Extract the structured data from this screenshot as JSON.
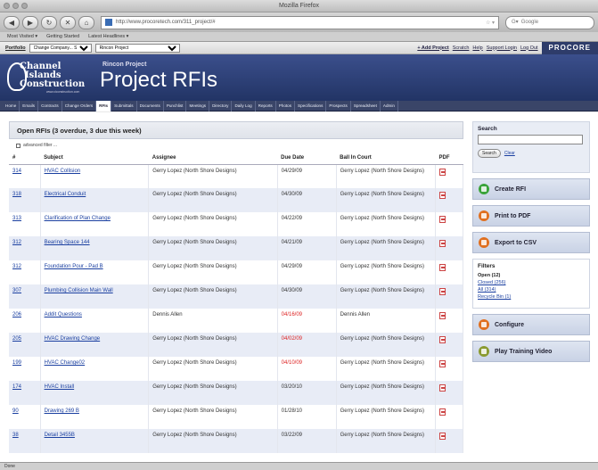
{
  "window": {
    "title": "Mozilla Firefox"
  },
  "browser": {
    "url": "http://www.procoretech.com/311_project/#",
    "search_placeholder": "Google",
    "bookmarks": [
      "Most Visited ▾",
      "Getting Started",
      "Latest Headlines ▾"
    ]
  },
  "appbar": {
    "portfolio_label": "Portfolio",
    "company_select": "Change Company... Supervisor ▾",
    "project_select": "Rincon Project",
    "links": [
      "+ Add Project",
      "Scratch",
      "Help",
      "Support Login",
      "Log Out"
    ],
    "brand": "PROCORE"
  },
  "header": {
    "logo": [
      "Channel",
      "Islands",
      "Construction",
      "www.ciconstruction.com"
    ],
    "subtitle": "Rincon Project",
    "title": "Project RFIs"
  },
  "tabs": [
    {
      "label": "Home",
      "active": false
    },
    {
      "label": "Emails",
      "active": false
    },
    {
      "label": "Contracts",
      "active": false
    },
    {
      "label": "Change Orders",
      "active": false
    },
    {
      "label": "RFIs",
      "active": true
    },
    {
      "label": "Submittals",
      "active": false
    },
    {
      "label": "Documents",
      "active": false
    },
    {
      "label": "Punchlist",
      "active": false
    },
    {
      "label": "Meetings",
      "active": false
    },
    {
      "label": "Directory",
      "active": false
    },
    {
      "label": "Daily Log",
      "active": false
    },
    {
      "label": "Reports",
      "active": false
    },
    {
      "label": "Photos",
      "active": false
    },
    {
      "label": "Specifications",
      "active": false
    },
    {
      "label": "Prospects",
      "active": false
    },
    {
      "label": "Spreadsheet",
      "active": false
    },
    {
      "label": "Admin",
      "active": false
    }
  ],
  "main": {
    "section_title": "Open RFIs (3 overdue, 3 due this week)",
    "advanced_filter": "advanced filter ..."
  },
  "table": {
    "headers": [
      "#",
      "Subject",
      "Assignee",
      "Due Date",
      "Ball In Court",
      "PDF"
    ],
    "rows": [
      {
        "num": "314",
        "subject": "HVAC Collision",
        "assignee": "Gerry Lopez (North Shore Designs)",
        "due": "04/29/09",
        "ball": "Gerry Lopez (North Shore Designs)",
        "overdue": false
      },
      {
        "num": "318",
        "subject": "Electrical Conduit",
        "assignee": "Gerry Lopez (North Shore Designs)",
        "due": "04/30/09",
        "ball": "Gerry Lopez (North Shore Designs)",
        "overdue": false
      },
      {
        "num": "313",
        "subject": "Clarification of Plan Change",
        "assignee": "Gerry Lopez (North Shore Designs)",
        "due": "04/22/09",
        "ball": "Gerry Lopez (North Shore Designs)",
        "overdue": false
      },
      {
        "num": "312",
        "subject": "Bearing Space 144",
        "assignee": "Gerry Lopez (North Shore Designs)",
        "due": "04/21/09",
        "ball": "Gerry Lopez (North Shore Designs)",
        "overdue": false
      },
      {
        "num": "312",
        "subject": "Foundation Pour - Pad B",
        "assignee": "Gerry Lopez (North Shore Designs)",
        "due": "04/29/09",
        "ball": "Gerry Lopez (North Shore Designs)",
        "overdue": false
      },
      {
        "num": "307",
        "subject": "Plumbing Collision Main Wall",
        "assignee": "Gerry Lopez (North Shore Designs)",
        "due": "04/30/09",
        "ball": "Gerry Lopez (North Shore Designs)",
        "overdue": false
      },
      {
        "num": "206",
        "subject": "Addit Questions",
        "assignee": "Dennis Allen",
        "due": "04/16/09",
        "ball": "Dennis Allen",
        "overdue": true
      },
      {
        "num": "205",
        "subject": "HVAC Drawing Change",
        "assignee": "Gerry Lopez (North Shore Designs)",
        "due": "04/02/09",
        "ball": "Gerry Lopez (North Shore Designs)",
        "overdue": true
      },
      {
        "num": "199",
        "subject": "HVAC Change02",
        "assignee": "Gerry Lopez (North Shore Designs)",
        "due": "04/10/09",
        "ball": "Gerry Lopez (North Shore Designs)",
        "overdue": true
      },
      {
        "num": "174",
        "subject": "HVAC Install",
        "assignee": "Gerry Lopez (North Shore Designs)",
        "due": "03/20/10",
        "ball": "Gerry Lopez (North Shore Designs)",
        "overdue": false
      },
      {
        "num": "90",
        "subject": "Drawing 269 B",
        "assignee": "Gerry Lopez (North Shore Designs)",
        "due": "01/28/10",
        "ball": "Gerry Lopez (North Shore Designs)",
        "overdue": false
      },
      {
        "num": "38",
        "subject": "Detail 3455B",
        "assignee": "Gerry Lopez (North Shore Designs)",
        "due": "03/22/09",
        "ball": "Gerry Lopez (North Shore Designs)",
        "overdue": false
      }
    ]
  },
  "sidebar": {
    "search_title": "Search",
    "search_button": "Search",
    "clear": "Clear",
    "create": "Create RFI",
    "print": "Print to PDF",
    "export": "Export to CSV",
    "filters_title": "Filters",
    "filters": [
      {
        "label": "Open (12)",
        "current": true
      },
      {
        "label": "Closed (256)",
        "current": false
      },
      {
        "label": "All (314)",
        "current": false
      },
      {
        "label": "Recycle Bin (1)",
        "current": false
      }
    ],
    "configure": "Configure",
    "training": "Play Training Video"
  },
  "statusbar": "Done"
}
